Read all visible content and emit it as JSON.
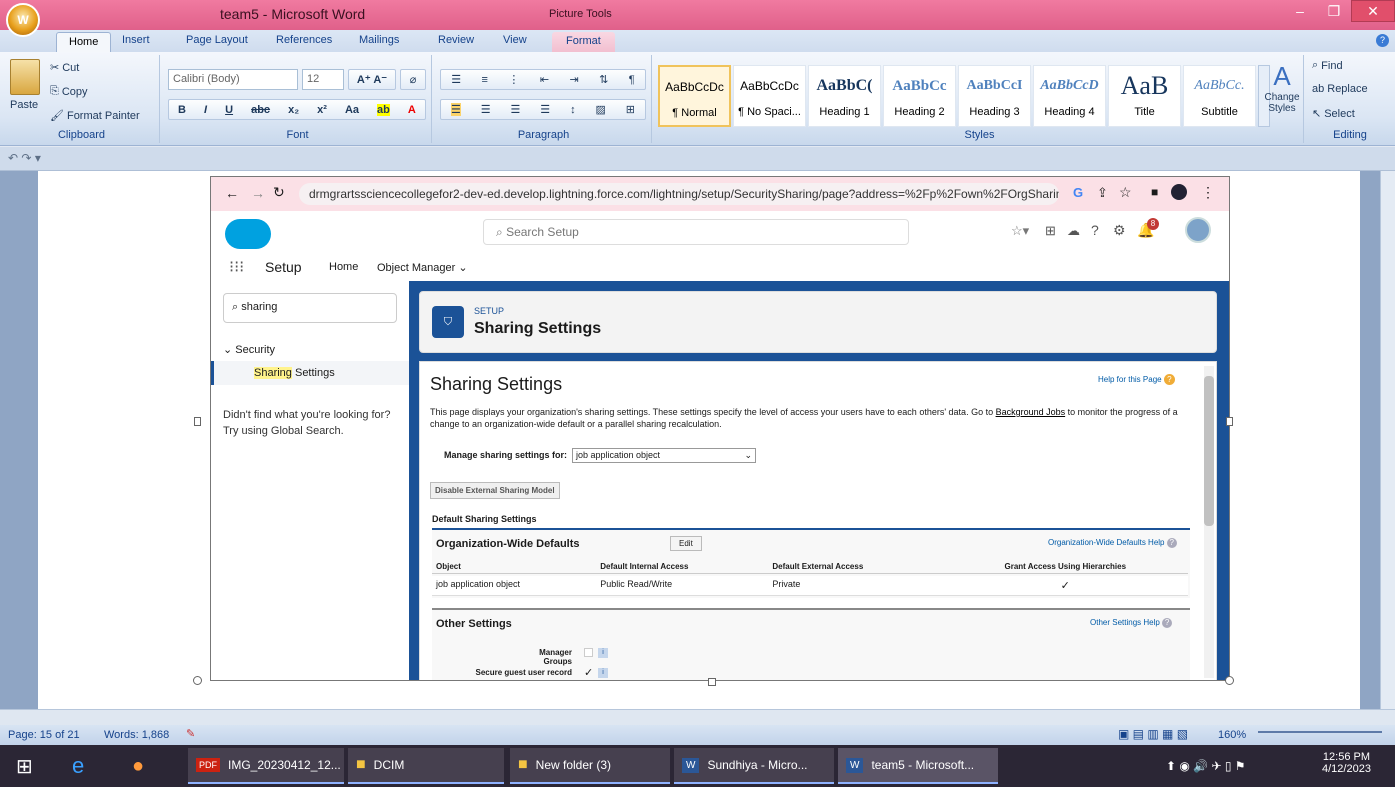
{
  "word": {
    "title": "team5 - Microsoft Word",
    "picture_tools": "Picture Tools",
    "tabs": [
      "Home",
      "Insert",
      "Page Layout",
      "References",
      "Mailings",
      "Review",
      "View",
      "Format"
    ],
    "clipboard": {
      "paste": "Paste",
      "cut": "Cut",
      "copy": "Copy",
      "format_painter": "Format Painter",
      "label": "Clipboard"
    },
    "font": {
      "name": "Calibri (Body)",
      "size": "12",
      "label": "Font"
    },
    "paragraph": {
      "label": "Paragraph"
    },
    "styles": {
      "label": "Styles",
      "items": [
        {
          "sample": "AaBbCcDc",
          "name": "¶ Normal"
        },
        {
          "sample": "AaBbCcDc",
          "name": "¶ No Spaci..."
        },
        {
          "sample": "AaBbC(",
          "name": "Heading 1"
        },
        {
          "sample": "AaBbCc",
          "name": "Heading 2"
        },
        {
          "sample": "AaBbCcI",
          "name": "Heading 3"
        },
        {
          "sample": "AaBbCcD",
          "name": "Heading 4"
        },
        {
          "sample": "AaB",
          "name": "Title"
        },
        {
          "sample": "AaBbCc.",
          "name": "Subtitle"
        }
      ],
      "change": "Change Styles"
    },
    "editing": {
      "find": "Find",
      "replace": "Replace",
      "select": "Select",
      "label": "Editing"
    },
    "status": {
      "page": "Page: 15 of 21",
      "words": "Words: 1,868",
      "zoom": "160%"
    }
  },
  "browser": {
    "url": "drmgrartssciencecollegefor2-dev-ed.develop.lightning.force.com/lightning/setup/SecuritySharing/page?address=%2Fp%2Fown%2FOrgSharingDetail..."
  },
  "sf": {
    "search_placeholder": "Search Setup",
    "app": "Setup",
    "nav": [
      "Home",
      "Object Manager"
    ],
    "notif_count": "8",
    "quickfind": "sharing",
    "tree_section": "Security",
    "tree_item": {
      "highlight": "Sharing",
      "rest": " Settings"
    },
    "not_found": "Didn't find what you're looking for?",
    "try_global": "Try using Global Search.",
    "header_eyebrow": "SETUP",
    "header_title": "Sharing Settings",
    "page_title": "Sharing Settings",
    "help_page": "Help for this Page",
    "description_1": "This page displays your organization's sharing settings. These settings specify the level of access your users have to each others' data. Go to ",
    "description_link": "Background Jobs",
    "description_2": " to monitor the progress of a change to an organization-wide default or a parallel sharing recalculation.",
    "manage_label": "Manage sharing settings for:",
    "manage_value": "job application object",
    "disable_btn": "Disable External Sharing Model",
    "default_sharing": "Default Sharing Settings",
    "owd_title": "Organization-Wide Defaults",
    "edit": "Edit",
    "owd_help": "Organization-Wide Defaults Help",
    "columns": [
      "Object",
      "Default Internal Access",
      "Default External Access",
      "Grant Access Using Hierarchies"
    ],
    "rows": [
      [
        "job application object",
        "Public Read/Write",
        "Private",
        "✓"
      ]
    ],
    "other_title": "Other Settings",
    "other_help": "Other Settings Help",
    "other_rows": [
      "Manager Groups",
      "Secure guest user record"
    ]
  },
  "taskbar": {
    "items": [
      "IMG_20230412_12...",
      "DCIM",
      "New folder (3)",
      "Sundhiya - Micro...",
      "team5 - Microsoft..."
    ],
    "time": "12:56 PM",
    "date": "4/12/2023"
  }
}
